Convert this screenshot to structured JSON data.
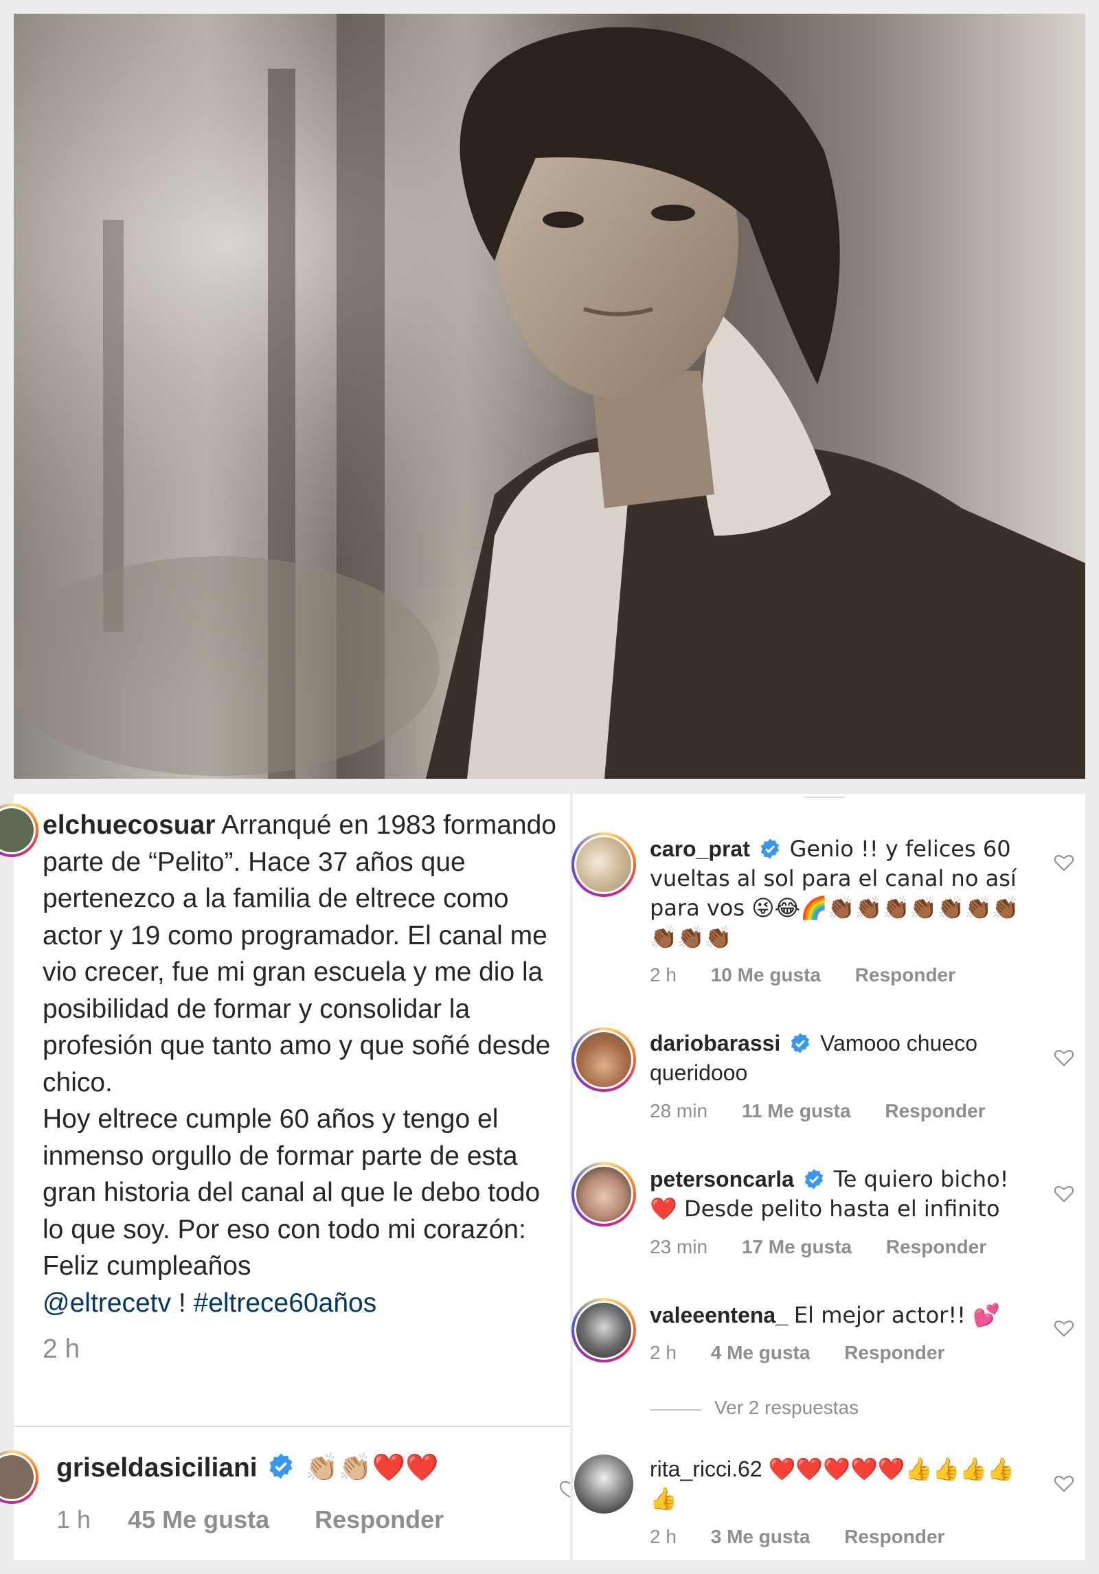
{
  "post": {
    "username": "elchuecosuar",
    "caption_1": "Arranqué en 1983 formando parte de “Pelito”. Hace 37 años que pertenezco a la familia de eltrece como actor y 19 como programador. El canal me vio crecer, fue mi gran escuela y me dio la posibilidad de formar y consolidar la profesión que tanto amo y que soñé desde chico.",
    "caption_2": "Hoy eltrece cumple 60 años y tengo el inmenso orgullo de formar parte de esta gran historia del canal al que le debo todo lo que soy.  Por eso con todo mi corazón: Feliz cumpleaños",
    "mention": "@eltrecetv",
    "sep": " ! ",
    "hashtag": "#eltrece60años",
    "time": "2 h",
    "photo_subject": "vintage-portrait-photo"
  },
  "left_comment": {
    "username": "griseldasiciliani",
    "text": "👏🏼👏🏼❤️❤️",
    "time": "1 h",
    "likes": "45 Me gusta",
    "reply": "Responder"
  },
  "comments": [
    {
      "username": "caro_prat",
      "text": "Genio !! y felices 60 vueltas al sol para el canal no así para vos 😜😂🌈👏🏾👏🏾👏🏾👏🏾👏🏾👏🏾👏🏾👏🏾👏🏾👏🏾",
      "time": "2 h",
      "likes": "10 Me gusta",
      "reply": "Responder"
    },
    {
      "username": "dariobarassi",
      "text": "Vamooo chueco queridooo",
      "time": "28 min",
      "likes": "11 Me gusta",
      "reply": "Responder"
    },
    {
      "username": "petersoncarla",
      "text": "Te quiero bicho! ❤️ Desde pelito hasta el infinito",
      "time": "23 min",
      "likes": "17 Me gusta",
      "reply": "Responder"
    },
    {
      "username": "valeeentena_",
      "text": "El mejor actor!! 💕",
      "time": "2 h",
      "likes": "4 Me gusta",
      "reply": "Responder"
    },
    {
      "username": "rita_ricci.62",
      "text": "❤️❤️❤️❤️❤️👍👍👍👍👍",
      "time": "2 h",
      "likes": "3 Me gusta",
      "reply": "Responder"
    }
  ],
  "view_replies": "Ver 2 respuestas",
  "colors": {
    "verified": "#3897f0",
    "link": "#00376b",
    "meta": "#8e8e8e",
    "heart": "#e0141e"
  },
  "icons": [
    "verified-badge-icon",
    "heart-outline-icon"
  ]
}
